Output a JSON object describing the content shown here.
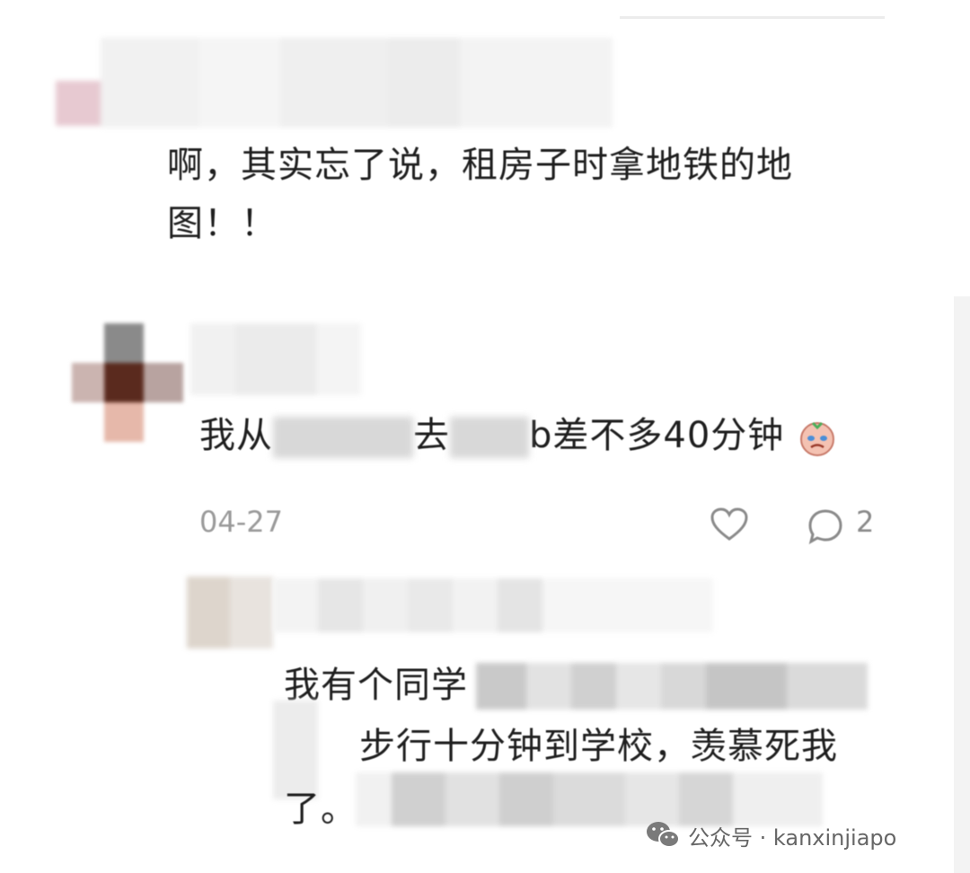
{
  "comment_1": {
    "text_line1": "啊，其实忘了说，租房子时拿地铁的地",
    "text_line2": "图！！"
  },
  "comment_2": {
    "text_prefix": "我从",
    "text_mid": "去",
    "text_suffix": "b差不多40分钟",
    "emoji": "crying-face-emoji",
    "date": "04-27",
    "reply_count": "2"
  },
  "reply_1": {
    "text_line1": "我有个同学",
    "text_line2": "步行十分钟到学校，羡慕死我",
    "text_line3": "了。"
  },
  "watermark": {
    "text": "公众号 · kanxinjiapo",
    "icon": "wechat-icon"
  },
  "colors": {
    "text": "#1e1e1e",
    "meta": "#9a9a9a",
    "blur_gray": "#d4d4d4",
    "avatar_dark": "#5a2a1e"
  }
}
